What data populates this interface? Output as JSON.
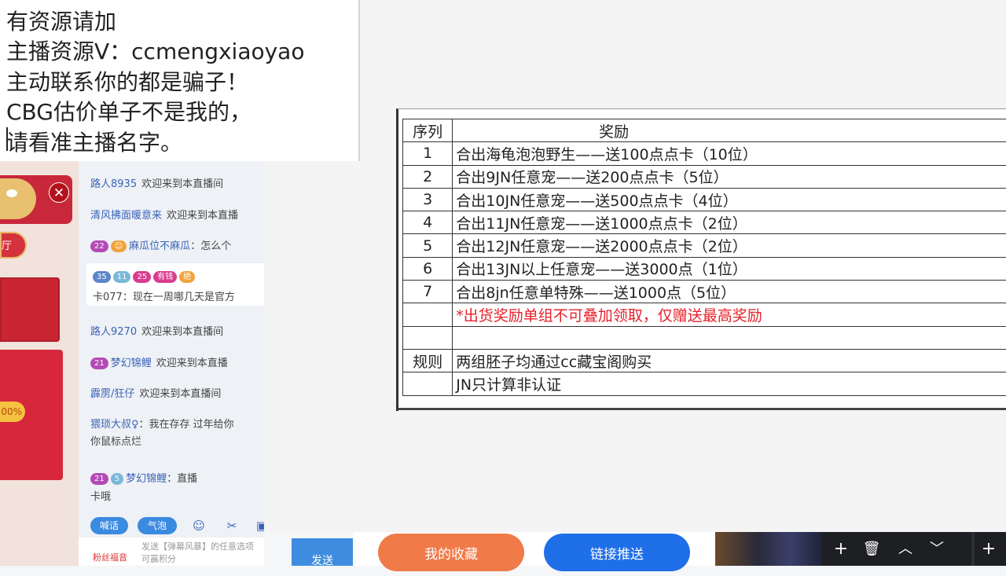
{
  "notice": {
    "lines": [
      "有资源请加",
      "主播资源V：ccmengxiaoyao",
      "主动联系你的都是骗子！",
      "CBG估价单子不是我的，",
      "请看准主播名字。"
    ]
  },
  "left_panel": {
    "badge_text": "厅",
    "percent": "00%"
  },
  "chat": {
    "messages": [
      {
        "user": "路人8935",
        "text": "欢迎来到本直播间"
      },
      {
        "user": "清风拂面暖意来",
        "text": "欢迎来到本直播"
      },
      {
        "level": "22",
        "user": "麻瓜位不麻瓜",
        "text": "：怎么个"
      },
      {
        "card_badges": [
          "35",
          "11",
          "25",
          "有钱",
          "绝"
        ],
        "user": "卡077",
        "text": "：现在一周哪几天是官方"
      },
      {
        "user": "路人9270",
        "text": "欢迎来到本直播间"
      },
      {
        "level": "21",
        "user": "梦幻锦鲤",
        "text": "欢迎来到本直播"
      },
      {
        "user": "霹雳/狂仔",
        "text": "欢迎来到本直播间"
      },
      {
        "user": "猥琐大叔♀",
        "text": "：我在存存  过年给你",
        "text2": "你鼠标点烂"
      },
      {
        "level": "21",
        "badge2": "5",
        "user": "梦幻锦鲤",
        "text": "：直播",
        "text2": "卡哦"
      }
    ],
    "tools": {
      "shout": "喊话",
      "bubble": "气泡"
    },
    "gift_label": "粉丝福音",
    "placeholder": "发送【弹幕风暴】的任意选项可赢积分",
    "send_label": "发送"
  },
  "reward_table": {
    "header": [
      "序列",
      "奖励"
    ],
    "rows": [
      {
        "idx": "1",
        "text": "合出海龟泡泡野生——送100点点卡（10位）"
      },
      {
        "idx": "2",
        "text": "合出9JN任意宠——送200点点卡（5位）"
      },
      {
        "idx": "3",
        "text": "合出10JN任意宠——送500点点卡（4位）"
      },
      {
        "idx": "4",
        "text": "合出11JN任意宠——送1000点点卡（2位）"
      },
      {
        "idx": "5",
        "text": "合出12JN任意宠——送2000点点卡（2位）"
      },
      {
        "idx": "6",
        "text": "合出13JN以上任意宠——送3000点（1位）"
      },
      {
        "idx": "7",
        "text": "合出8jn任意单特殊——送1000点（5位）"
      },
      {
        "idx": "",
        "text": "*出货奖励单组不可叠加领取，仅赠送最高奖励"
      },
      {
        "idx": "",
        "text": ""
      },
      {
        "idx": "规则",
        "text": "两组胚子均通过cc藏宝阁购买"
      },
      {
        "idx": "",
        "text": "JN只计算非认证"
      }
    ]
  },
  "bottom": {
    "favorites_label": "我的收藏",
    "push_label": "链接推送"
  },
  "colors": {
    "accent_blue": "#1f6fe8",
    "accent_orange": "#f07a48",
    "warning_red": "#e8202a"
  }
}
